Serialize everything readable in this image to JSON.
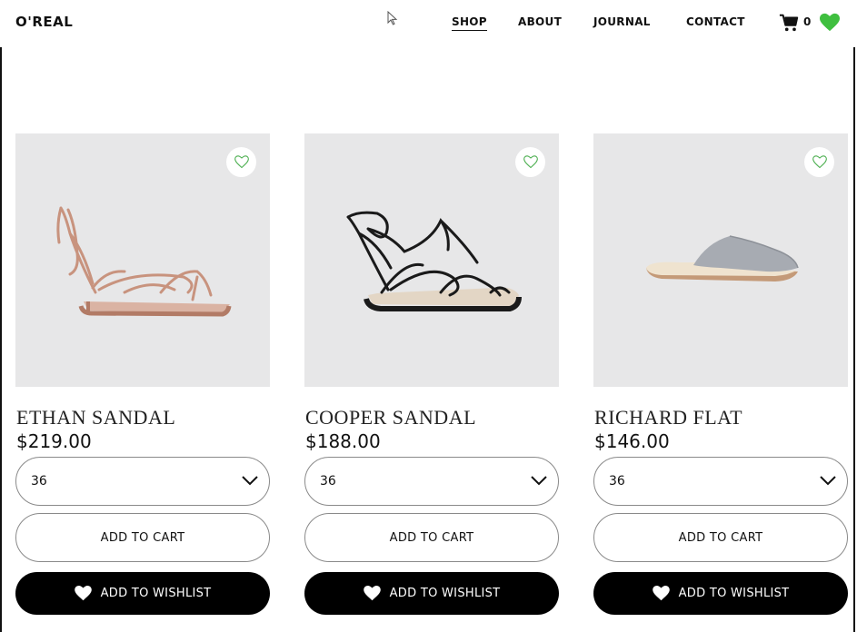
{
  "header": {
    "logo": "O'REAL",
    "nav": [
      {
        "label": "SHOP",
        "active": true
      },
      {
        "label": "ABOUT",
        "active": false
      },
      {
        "label": "JOURNAL",
        "active": false
      },
      {
        "label": "CONTACT",
        "active": false
      }
    ],
    "cart_icon": "cart-icon",
    "cart_count": "0",
    "wishlist_icon": "heart-icon",
    "wishlist_color": "#3fbf3f"
  },
  "products": [
    {
      "name": "ETHAN SANDAL",
      "price": "$219.00",
      "size": "36",
      "add_label": "ADD TO CART",
      "wishlist_label": "ADD TO WISHLIST",
      "shoe_color": "#c8937e"
    },
    {
      "name": "COOPER SANDAL",
      "price": "$188.00",
      "size": "36",
      "add_label": "ADD TO CART",
      "wishlist_label": "ADD TO WISHLIST",
      "shoe_color": "#1a1a1a"
    },
    {
      "name": "RICHARD FLAT",
      "price": "$146.00",
      "size": "36",
      "add_label": "ADD TO CART",
      "wishlist_label": "ADD TO WISHLIST",
      "shoe_color": "#9fa3aa"
    }
  ],
  "colors": {
    "image_bg": "#e7e7e8",
    "fav_heart": "#4caf50",
    "button_dark": "#000000"
  }
}
